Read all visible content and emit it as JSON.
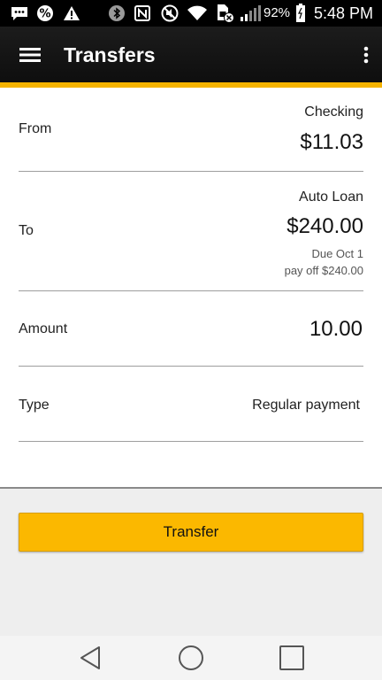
{
  "status_bar": {
    "battery": "92%",
    "time": "5:48 PM",
    "icons": [
      "chat-bubble-icon",
      "percent-icon",
      "warning-icon",
      "bluetooth-icon",
      "nfc-icon",
      "mute-icon",
      "wifi-icon",
      "sim-error-icon",
      "signal-icon",
      "battery-icon"
    ]
  },
  "app_bar": {
    "title": "Transfers",
    "menu_icon": "hamburger-menu-icon",
    "overflow_icon": "more-vertical-icon",
    "accent_color": "#f5b300"
  },
  "form": {
    "from": {
      "label": "From",
      "account": "Checking",
      "amount": "$11.03"
    },
    "to": {
      "label": "To",
      "account": "Auto Loan",
      "amount": "$240.00",
      "due": "Due Oct 1",
      "payoff": "pay off $240.00"
    },
    "amount": {
      "label": "Amount",
      "value": "10.00"
    },
    "type": {
      "label": "Type",
      "value": "Regular payment"
    }
  },
  "transfer_button": {
    "label": "Transfer",
    "color": "#fbb800"
  },
  "nav_bar": {
    "icons": [
      "back-icon",
      "home-icon",
      "recents-icon"
    ]
  }
}
